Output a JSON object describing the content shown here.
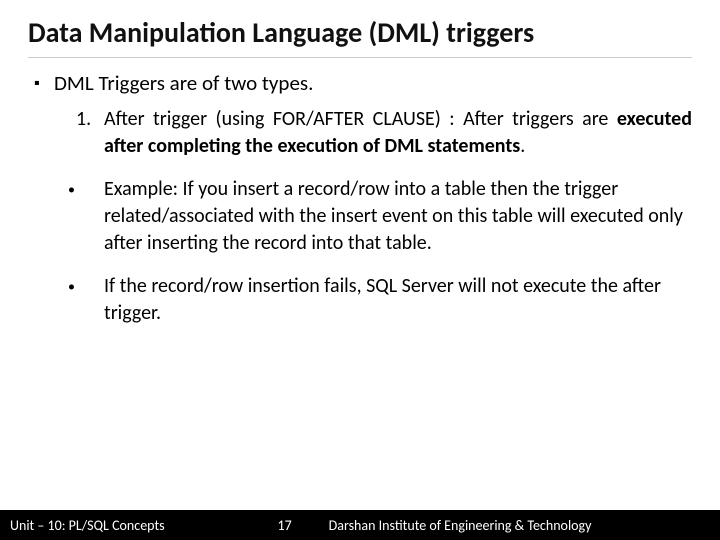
{
  "title": "Data Manipulation Language (DML) triggers",
  "intro": "DML Triggers are of two types.",
  "item1": {
    "num": "1.",
    "pre": "After trigger (using FOR/AFTER CLAUSE) : After triggers are ",
    "bold": "executed after completing the execution of DML statements",
    "post": "."
  },
  "bullets": [
    "Example: If you insert a record/row into a table then the trigger related/associated with the insert event on this table will executed only after inserting the record into that table.",
    "If the record/row insertion fails, SQL Server will not execute the after trigger."
  ],
  "footer": {
    "unit": "Unit – 10: PL/SQL Concepts",
    "page": "17",
    "institute": "Darshan Institute of Engineering & Technology"
  }
}
